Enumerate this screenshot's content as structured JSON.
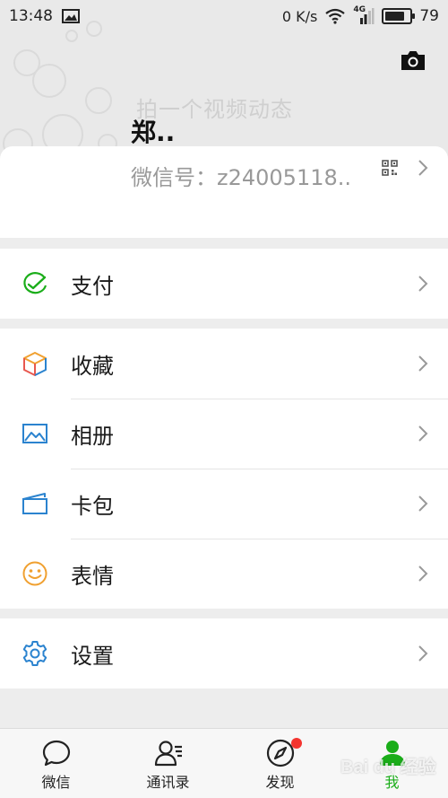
{
  "status_bar": {
    "time": "13:48",
    "net_speed": "0 K/s",
    "network_type": "4G",
    "battery": "79"
  },
  "header": {
    "video_hint": "拍一个视频动态",
    "username": "郑..",
    "wechat_id": "微信号：z24005118.."
  },
  "menu": {
    "pay": "支付",
    "favorites": "收藏",
    "album": "相册",
    "cards": "卡包",
    "stickers": "表情",
    "settings": "设置"
  },
  "tabs": [
    {
      "label": "微信"
    },
    {
      "label": "通讯录"
    },
    {
      "label": "发现"
    },
    {
      "label": "我"
    }
  ],
  "colors": {
    "accent_green": "#1aad19",
    "badge_red": "#f43530",
    "icon_blue": "#2b83cf",
    "icon_orange": "#f0a030"
  },
  "watermark": "Bai du 经验"
}
